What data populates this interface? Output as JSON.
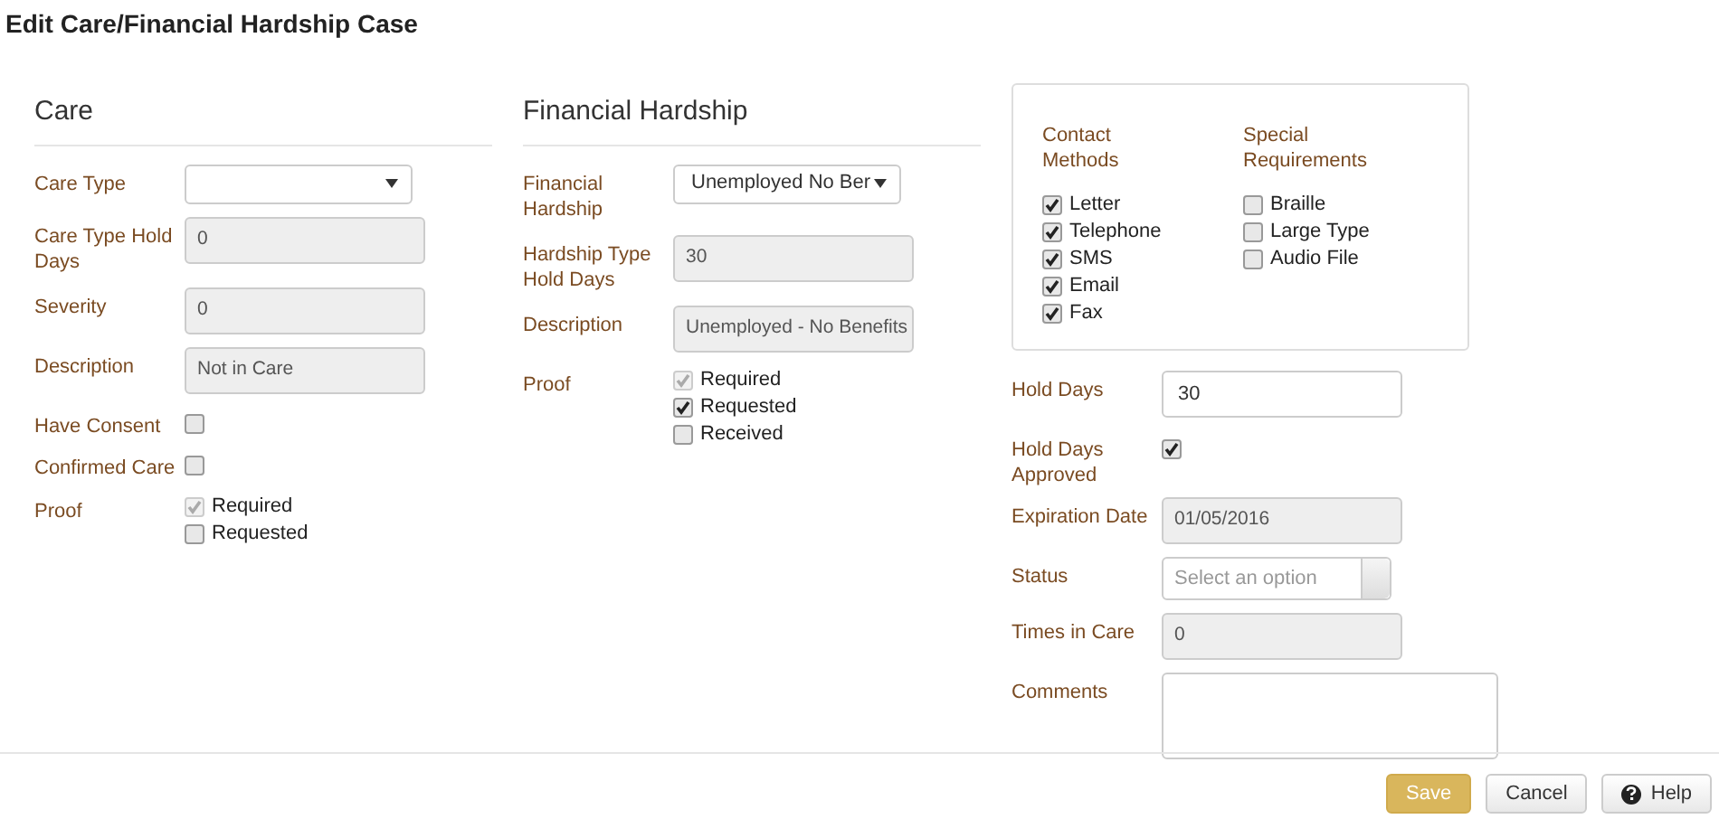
{
  "title": "Edit Care/Financial Hardship Case",
  "care": {
    "heading": "Care",
    "fields": [
      {
        "kind": "select",
        "label": "Care Type"
      },
      {
        "kind": "readonly",
        "label": "Care Type Hold Days",
        "value": "0"
      },
      {
        "kind": "readonly",
        "label": "Severity",
        "value": "0"
      },
      {
        "kind": "readonly",
        "label": "Description",
        "value": "Not in Care"
      },
      {
        "kind": "checkbox",
        "label": "Have Consent",
        "checked": false
      },
      {
        "kind": "checkbox",
        "label": "Confirmed Care",
        "checked": false
      },
      {
        "kind": "checkgroup",
        "label": "Proof",
        "options": [
          {
            "label": "Required",
            "checked": true,
            "disabled": true
          },
          {
            "label": "Requested",
            "checked": false,
            "disabled": false
          }
        ]
      }
    ]
  },
  "financial_hardship": {
    "heading": "Financial Hardship",
    "fields": [
      {
        "kind": "select",
        "label": "Financial Hardship",
        "value": "Unemployed No Ber"
      },
      {
        "kind": "readonly",
        "label": "Hardship Type Hold Days",
        "value": "30"
      },
      {
        "kind": "readonly",
        "label": "Description",
        "value": "Unemployed - No Benefits"
      },
      {
        "kind": "checkgroup",
        "label": "Proof",
        "options": [
          {
            "label": "Required",
            "checked": true,
            "disabled": true
          },
          {
            "label": "Requested",
            "checked": true,
            "disabled": false
          },
          {
            "label": "Received",
            "checked": false,
            "disabled": false
          }
        ]
      }
    ]
  },
  "contact_methods": {
    "heading": "Contact Methods",
    "options": [
      {
        "label": "Letter",
        "checked": true
      },
      {
        "label": "Telephone",
        "checked": true
      },
      {
        "label": "SMS",
        "checked": true
      },
      {
        "label": "Email",
        "checked": true
      },
      {
        "label": "Fax",
        "checked": true
      }
    ]
  },
  "special_requirements": {
    "heading": "Special Requirements",
    "options": [
      {
        "label": "Braille",
        "checked": false
      },
      {
        "label": "Large Type",
        "checked": false
      },
      {
        "label": "Audio File",
        "checked": false
      }
    ]
  },
  "details": [
    {
      "kind": "text",
      "label": "Hold Days",
      "value": "30"
    },
    {
      "kind": "checkbox",
      "label": "Hold Days Approved",
      "checked": true
    },
    {
      "kind": "readonly",
      "label": "Expiration Date",
      "value": "01/05/2016"
    },
    {
      "kind": "combo",
      "label": "Status",
      "placeholder": "Select an option"
    },
    {
      "kind": "readonly",
      "label": "Times in Care",
      "value": "0"
    },
    {
      "kind": "textarea",
      "label": "Comments"
    }
  ],
  "buttons": [
    {
      "kind": "primary",
      "label": "Save"
    },
    {
      "kind": "default",
      "label": "Cancel"
    },
    {
      "kind": "help",
      "label": "Help"
    }
  ]
}
